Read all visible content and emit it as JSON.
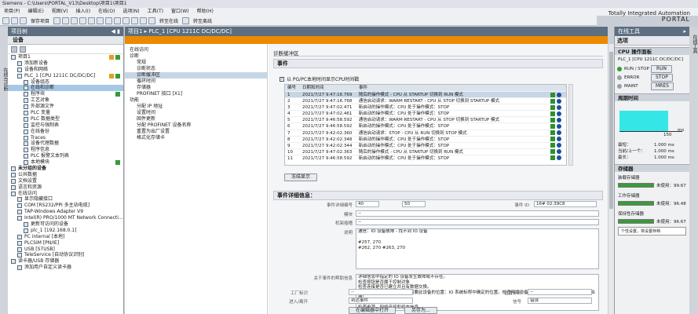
{
  "window": {
    "title": "Siemens  -  C:\\Users\\PORTAL_V13\\Desktop\\项目1\\项目1"
  },
  "menus": [
    "项目(P)",
    "编辑(E)",
    "视图(V)",
    "插入(I)",
    "在线(O)",
    "选项(N)",
    "工具(T)",
    "窗口(W)",
    "帮助(H)"
  ],
  "toolbar": {
    "save": "保存项目",
    "online": "转至在线",
    "offline": "转至离线"
  },
  "branding": {
    "line1": "Totally Integrated Automation",
    "line2": "PORTAL"
  },
  "left_strip": "在线与诊断",
  "project_tree": {
    "title": "项目树",
    "devices_tab": "设备",
    "rows": [
      {
        "label": "项目1",
        "lvl": 0,
        "ok": true,
        "warn": true
      },
      {
        "label": "添加新设备",
        "lvl": 1
      },
      {
        "label": "设备和网络",
        "lvl": 1
      },
      {
        "label": "PLC_1 [CPU 1211C DC/DC/DC]",
        "lvl": 1,
        "ok": true,
        "warn": true
      },
      {
        "label": "设备组态",
        "lvl": 2
      },
      {
        "label": "在线和诊断",
        "lvl": 2,
        "sel": true
      },
      {
        "label": "程序块",
        "lvl": 2,
        "ok": true
      },
      {
        "label": "工艺对象",
        "lvl": 2
      },
      {
        "label": "外部源文件",
        "lvl": 2
      },
      {
        "label": "PLC 变量",
        "lvl": 2
      },
      {
        "label": "PLC 数据类型",
        "lvl": 2
      },
      {
        "label": "监控与强制表",
        "lvl": 2
      },
      {
        "label": "在线备份",
        "lvl": 2
      },
      {
        "label": "Traces",
        "lvl": 2
      },
      {
        "label": "设备代理数据",
        "lvl": 2
      },
      {
        "label": "程序信息",
        "lvl": 2
      },
      {
        "label": "PLC 报警文本列表",
        "lvl": 2
      },
      {
        "label": "本地模块",
        "lvl": 2,
        "ok": true
      },
      {
        "label": "未分组的设备",
        "lvl": 0,
        "grp": true
      },
      {
        "label": "公共数据",
        "lvl": 0
      },
      {
        "label": "文档设置",
        "lvl": 0
      },
      {
        "label": "语言和资源",
        "lvl": 0
      },
      {
        "label": "在线访问",
        "lvl": 0
      },
      {
        "label": "显示隐藏接口",
        "lvl": 1
      },
      {
        "label": "COM [RS232/PPI 多主站电缆]",
        "lvl": 1
      },
      {
        "label": "TAP-Windows Adapter V9",
        "lvl": 1
      },
      {
        "label": "Intel(R) PRO/1000 MT Network Connecti...",
        "lvl": 1
      },
      {
        "label": "更新可访问的设备",
        "lvl": 2
      },
      {
        "label": "plc_1 [192.168.0.1]",
        "lvl": 2
      },
      {
        "label": "PC internal [本地]",
        "lvl": 1
      },
      {
        "label": "PLCSIM [PN/IE]",
        "lvl": 1
      },
      {
        "label": "USB [S7USB]",
        "lvl": 1
      },
      {
        "label": "TeleService [自动协议识别]",
        "lvl": 1
      },
      {
        "label": "读卡器/USB 存储器",
        "lvl": 0
      },
      {
        "label": "添加用户自定义读卡器",
        "lvl": 1
      }
    ]
  },
  "editor": {
    "title": "项目1 ▸ PLC_1 [CPU 1211C DC/DC/DC]",
    "breadcrumb": "在线访问"
  },
  "nav": [
    {
      "label": "在线访问",
      "lvl": 0
    },
    {
      "label": "诊断",
      "lvl": 0
    },
    {
      "label": "常规",
      "lvl": 1
    },
    {
      "label": "诊断状态",
      "lvl": 1
    },
    {
      "label": "诊断缓冲区",
      "lvl": 1,
      "sel": true
    },
    {
      "label": "循环时间",
      "lvl": 1
    },
    {
      "label": "存储器",
      "lvl": 1
    },
    {
      "label": "PROFINET 接口 [X1]",
      "lvl": 1
    },
    {
      "label": "功能",
      "lvl": 0
    },
    {
      "label": "分配 IP 地址",
      "lvl": 1
    },
    {
      "label": "设置时间",
      "lvl": 1
    },
    {
      "label": "固件更新",
      "lvl": 1
    },
    {
      "label": "分配 PROFINET 设备名称",
      "lvl": 1
    },
    {
      "label": "重置为出厂设置",
      "lvl": 1
    },
    {
      "label": "格式化存储卡",
      "lvl": 1
    }
  ],
  "buffer": {
    "heading": "诊断缓冲区",
    "events": "事件",
    "checkbox": "以 PG/PC本地时间显示CPU时间戳",
    "cols": [
      "编号",
      "日期和时间",
      "事件"
    ],
    "rows": [
      [
        "1",
        "2021/7/27 9:47:16.769",
        "随后的操作模式 - CPU 从 STARTUP 切换到 RUN 模式"
      ],
      [
        "2",
        "2021/7/27 9:47:16.768",
        "通信启动请求：WARM RESTART - CPU 从 STOP 切换到 STARTUP 模式"
      ],
      [
        "3",
        "2021/7/27 9:47:02.471",
        "新启动的操作模式：CPU 处于操作模式：STOP"
      ],
      [
        "4",
        "2021/7/27 9:47:02.461",
        "新启动的操作模式：CPU 处于操作模式：STOP"
      ],
      [
        "5",
        "2021/7/27 9:46:58.592",
        "通信启动请求：WARM RESTART - CPU 从 STOP 切换到 STARTUP 模式"
      ],
      [
        "6",
        "2021/7/27 9:46:58.592",
        "新启动的操作模式：CPU 处于操作模式：STOP"
      ],
      [
        "7",
        "2021/7/27 9:42:02.360",
        "通信启动请求：STOP - CPU 从 RUN 切换到 STOP 模式"
      ],
      [
        "8",
        "2021/7/27 9:42:02.348",
        "新启动的操作模式：CPU 处于操作模式：STOP"
      ],
      [
        "9",
        "2021/7/27 9:42:02.344",
        "新启动的操作模式：CPU 处于操作模式：STOP"
      ],
      [
        "10",
        "2021/7/27 9:47:02.363",
        "随后的操作模式 - CPU 从 STARTUP 切换到 RUN 模式"
      ],
      [
        "11",
        "2021/7/27 9:46:58.592",
        "新启动的操作模式：CPU 处于操作模式：STOP"
      ]
    ],
    "freeze_btn": "冻结显示"
  },
  "details": {
    "heading": "事件详细信息：",
    "event_no_label": "事件详细编号",
    "event_no": "40",
    "event_total": "50",
    "event_id_label": "事件 ID",
    "event_id": "16# 02:39C8",
    "module_label": "模块",
    "module_val": "--",
    "rack_label": "机架插槽",
    "rack_val": "--",
    "desc_label": "说明",
    "desc": [
      "通信：IO 设备故障 - 找不到 IO 设备",
      "",
      "#257, 270",
      "#262, 270 #263, 270"
    ],
    "help_label": "关于事件的帮助信息",
    "help": [
      "详细信息中指定的 IO 设备发生故障或不存在。",
      "检查按钮是否属于控制对象",
      "检查连接是否已建立并且有数据交换。",
      "检查在实际应用过程中是否需要此设备的位置：IO 系统标称中确定的位置。检查网络设备类型（例如：智能设备，IE-IE 耦合器）",
      "解决方法",
      "检查电源，网络连接和组态信息。",
      "- 无法在国内中检测到 IO 设备"
    ],
    "op_label": "工厂标识",
    "op_val": "--",
    "loc_label": "位置标识",
    "loc_val": "--",
    "state_label": "进入/离开",
    "state_val": "到达事件",
    "type_label": "信号",
    "type_val": "错误",
    "editor_btn": "在编辑器中打开",
    "save_btn": "另存为..."
  },
  "online_tools": {
    "title": "在线工具",
    "options": "选项",
    "cpu_panel": "CPU 操作面板",
    "cpu_name": "PLC_1 [CPU 1211C DC/DC/DC]",
    "run_stop": "RUN / STOP",
    "run_btn": "RUN",
    "error": "ERROR",
    "stop_btn": "STOP",
    "maint": "MAINT",
    "mres_btn": "MRES",
    "cycle": "周期时间",
    "axis_max": "150",
    "axis_unit": "ms",
    "shortest_label": "最短：",
    "shortest": "1.000 ms",
    "current_label": "当前/上一个：",
    "current": "1.000 ms",
    "longest_label": "最长：",
    "longest": "1.000 ms",
    "memory": "存储器",
    "load": "装载存储器",
    "load_free": "未使用：99.67",
    "work": "工作存储器",
    "work_free": "未使用：96.48",
    "retain": "保持性存储器",
    "retain_free": "未使用：96.67",
    "tip": "个性设置，将设置存档"
  },
  "right_strip": "在线工具",
  "colors": {
    "header": "#5c6e80",
    "accent": "#eb8a00",
    "ok": "#2f8f2f",
    "chart": "#35e6e6"
  }
}
